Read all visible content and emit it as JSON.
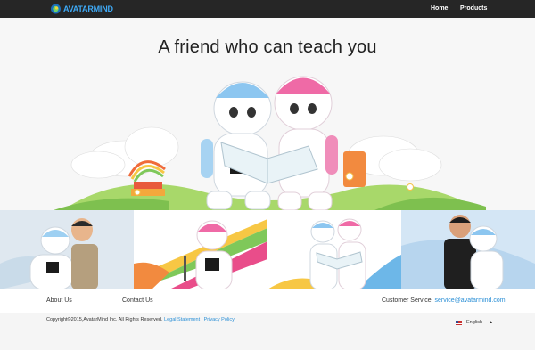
{
  "header": {
    "logo_text": "AVATARMIND",
    "nav": [
      {
        "label": "Home"
      },
      {
        "label": "Products"
      }
    ]
  },
  "hero": {
    "title": "A friend who can teach you"
  },
  "footer": {
    "about": "About Us",
    "contact": "Contact Us",
    "service_label": "Customer Service: ",
    "service_email": "service@avatarmind.com",
    "copyright": "Copyright©2015,AvatarMind Inc. All Rights Reserved.",
    "legal": "Legal Statement",
    "separator": " | ",
    "privacy": "Privacy Policy",
    "language": "English"
  },
  "colors": {
    "topbar": "#262626",
    "link": "#2a8fd6",
    "accent_blue": "#8cc6f0",
    "accent_pink": "#ef6aa6"
  }
}
